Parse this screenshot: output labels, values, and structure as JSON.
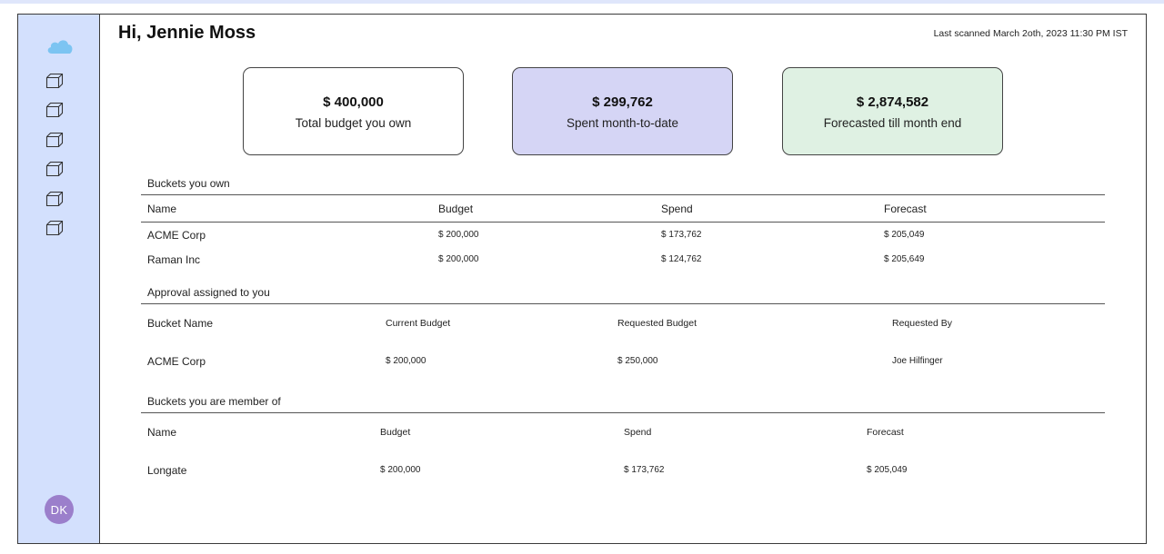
{
  "header": {
    "greeting": "Hi, Jennie Moss",
    "last_scanned": "Last scanned March 2oth, 2023 11:30 PM IST"
  },
  "sidebar": {
    "logo_icon": "cloud-icon",
    "items": [
      {
        "icon": "cube-icon"
      },
      {
        "icon": "cube-icon"
      },
      {
        "icon": "cube-icon"
      },
      {
        "icon": "cube-icon"
      },
      {
        "icon": "cube-icon"
      },
      {
        "icon": "cube-icon"
      }
    ],
    "avatar_initials": "DK"
  },
  "cards": {
    "owned": {
      "value": "$ 400,000",
      "label": "Total budget you own"
    },
    "spent": {
      "value": "$ 299,762",
      "label": "Spent month-to-date"
    },
    "forecast": {
      "value": "$ 2,874,582",
      "label": "Forecasted till month end"
    }
  },
  "buckets_owned": {
    "title": "Buckets you own",
    "columns": [
      "Name",
      "Budget",
      "Spend",
      "Forecast"
    ],
    "rows": [
      [
        "ACME Corp",
        "$ 200,000",
        "$ 173,762",
        "$ 205,049"
      ],
      [
        "Raman Inc",
        "$ 200,000",
        "$ 124,762",
        "$ 205,649"
      ]
    ]
  },
  "approvals": {
    "title": "Approval assigned to you",
    "columns": [
      "Bucket Name",
      "Current Budget",
      "Requested Budget",
      "Requested By"
    ],
    "rows": [
      [
        "ACME Corp",
        "$ 200,000",
        "$ 250,000",
        "Joe Hilfinger"
      ]
    ]
  },
  "buckets_member": {
    "title": "Buckets you are member of",
    "columns": [
      "Name",
      "Budget",
      "Spend",
      "Forecast"
    ],
    "rows": [
      [
        "Longate",
        "$ 200,000",
        "$ 173,762",
        "$ 205,049"
      ]
    ]
  },
  "colors": {
    "sidebar_bg": "#d3e0fd",
    "cloud": "#7cc4f2",
    "avatar_bg": "#9b7fcb",
    "spent_card_bg": "#d5d5f5",
    "forecast_card_bg": "#dff1e3"
  }
}
